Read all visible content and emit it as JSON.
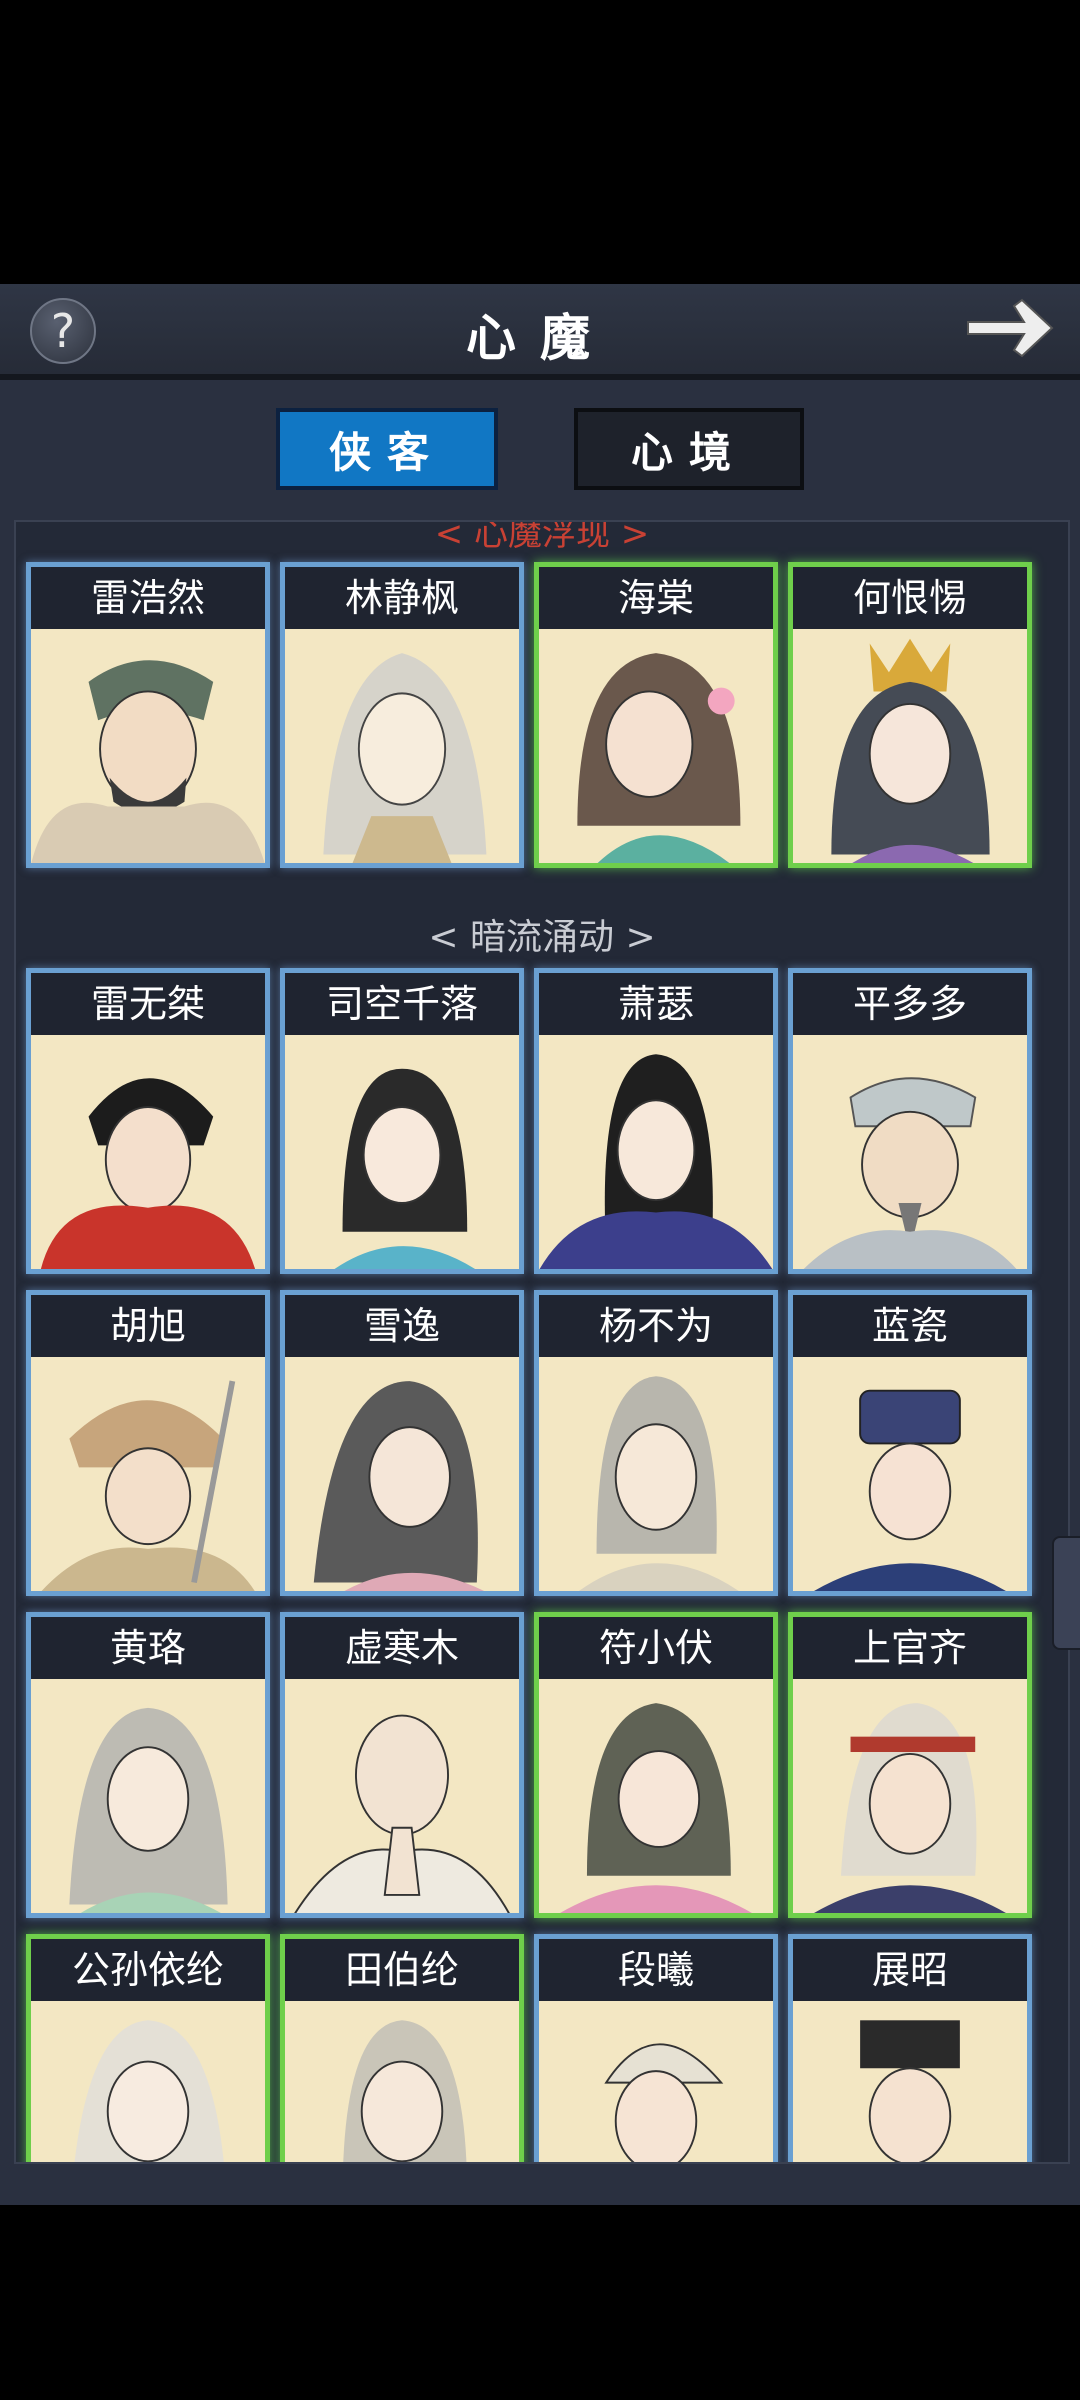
{
  "header": {
    "title": "心魔"
  },
  "tabs": {
    "active": "侠客",
    "inactive": "心境"
  },
  "sections": {
    "top_partial": "< 心魔浮现 >",
    "middle": "< 暗流涌动 >"
  },
  "characters_row1": [
    "雷浩然",
    "林静枫",
    "海棠",
    "何恨惕"
  ],
  "characters": [
    [
      "雷无桀",
      "司空千落",
      "萧瑟",
      "平多多"
    ],
    [
      "胡旭",
      "雪逸",
      "杨不为",
      "蓝瓷"
    ],
    [
      "黄珞",
      "虚寒木",
      "符小伏",
      "上官齐"
    ],
    [
      "公孙依纶",
      "田伯纶",
      "段曦",
      "展昭"
    ]
  ],
  "colors": {
    "blue_frame": "#6aa0d2",
    "green_frame": "#6fcf4b",
    "tab_active": "#1177c4"
  }
}
